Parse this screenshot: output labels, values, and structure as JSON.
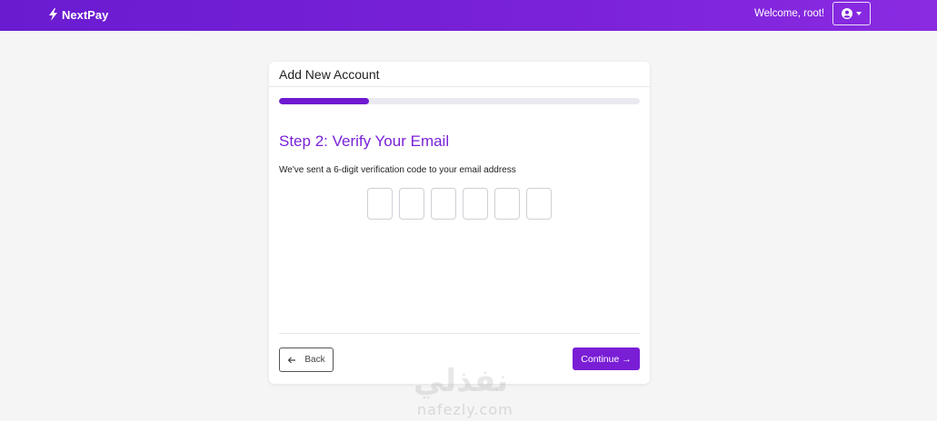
{
  "navbar": {
    "brand": "NextPay",
    "brand_icon": "bolt-icon",
    "welcome": "Welcome, root!",
    "user_icon": "user-circle-icon",
    "accent_color": "#7a22d8"
  },
  "card": {
    "title": "Add New Account",
    "progress_fraction": 0.25,
    "step_title": "Step 2: Verify Your Email",
    "description": "We've sent a 6-digit verification code to your email address",
    "code_digits": [
      "",
      "",
      "",
      "",
      "",
      ""
    ],
    "back_label": "Back",
    "back_icon": "arrow-left-icon",
    "continue_label": "Continue →"
  },
  "watermark": {
    "arabic": "نفذلي",
    "latin": "nafezly.com"
  }
}
